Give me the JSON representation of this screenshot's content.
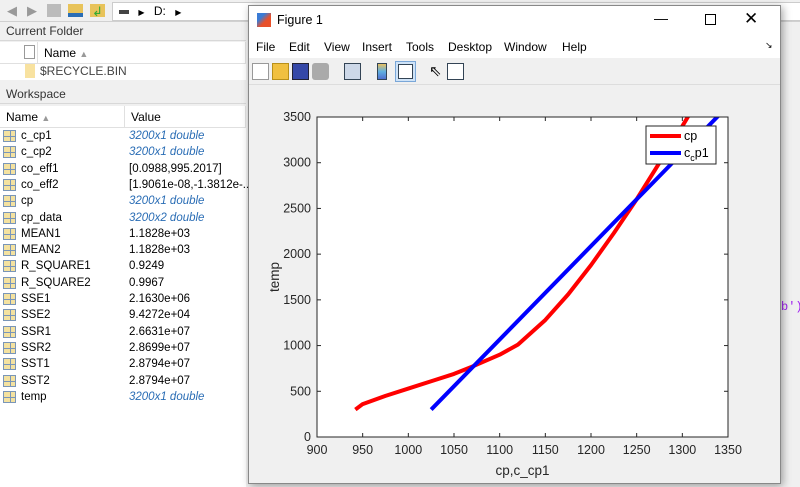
{
  "toolbar": {
    "drive": "D:",
    "icons": [
      "back-arrow-icon",
      "forward-arrow-icon",
      "up-folder-icon",
      "browse-folder-icon",
      "folder-up-icon",
      "drive-icon"
    ]
  },
  "current_folder": {
    "title": "Current Folder",
    "col_name": "Name",
    "items": [
      "$RECYCLE.BIN"
    ]
  },
  "workspace": {
    "title": "Workspace",
    "col_name": "Name",
    "col_value": "Value",
    "rows": [
      {
        "name": "c_cp1",
        "value": "3200x1 double",
        "italic": true
      },
      {
        "name": "c_cp2",
        "value": "3200x1 double",
        "italic": true
      },
      {
        "name": "co_eff1",
        "value": "[0.0988,995.2017]",
        "italic": false
      },
      {
        "name": "co_eff2",
        "value": "[1.9061e-08,-1.3812e-...",
        "italic": false
      },
      {
        "name": "cp",
        "value": "3200x1 double",
        "italic": true
      },
      {
        "name": "cp_data",
        "value": "3200x2 double",
        "italic": true
      },
      {
        "name": "MEAN1",
        "value": "1.1828e+03",
        "italic": false
      },
      {
        "name": "MEAN2",
        "value": "1.1828e+03",
        "italic": false
      },
      {
        "name": "R_SQUARE1",
        "value": "0.9249",
        "italic": false
      },
      {
        "name": "R_SQUARE2",
        "value": "0.9967",
        "italic": false
      },
      {
        "name": "SSE1",
        "value": "2.1630e+06",
        "italic": false
      },
      {
        "name": "SSE2",
        "value": "9.4272e+04",
        "italic": false
      },
      {
        "name": "SSR1",
        "value": "2.6631e+07",
        "italic": false
      },
      {
        "name": "SSR2",
        "value": "2.8699e+07",
        "italic": false
      },
      {
        "name": "SST1",
        "value": "2.8794e+07",
        "italic": false
      },
      {
        "name": "SST2",
        "value": "2.8794e+07",
        "italic": false
      },
      {
        "name": "temp",
        "value": "3200x1 double",
        "italic": true
      }
    ]
  },
  "editor_fragment": "b')",
  "figure": {
    "title": "Figure 1",
    "menus": [
      "File",
      "Edit",
      "View",
      "Insert",
      "Tools",
      "Desktop",
      "Window",
      "Help"
    ],
    "toolbar_icons": [
      "new-figure-icon",
      "open-file-icon",
      "save-icon",
      "print-icon",
      "link-plot-icon",
      "colorbar-icon",
      "legend-icon",
      "pointer-icon",
      "property-editor-icon"
    ]
  },
  "chart_data": {
    "type": "line",
    "xlabel": "cp,c_cp1",
    "ylabel": "temp",
    "xlim": [
      900,
      1350
    ],
    "ylim": [
      0,
      3500
    ],
    "xticks": [
      900,
      950,
      1000,
      1050,
      1100,
      1150,
      1200,
      1250,
      1300,
      1350
    ],
    "yticks": [
      0,
      500,
      1000,
      1500,
      2000,
      2500,
      3000,
      3500
    ],
    "legend": "top-right",
    "series": [
      {
        "name": "cp",
        "color": "#ff0000",
        "x": [
          942,
          950,
          975,
          1000,
          1025,
          1050,
          1070,
          1100,
          1120,
          1150,
          1175,
          1200,
          1225,
          1250,
          1275,
          1300,
          1312
        ],
        "y": [
          300,
          360,
          450,
          530,
          610,
          690,
          770,
          900,
          1010,
          1280,
          1560,
          1880,
          2230,
          2600,
          3000,
          3400,
          3600
        ]
      },
      {
        "name": "c_cp1",
        "color": "#0000ff",
        "x": [
          1025,
          1345
        ],
        "y": [
          300,
          3570
        ]
      }
    ]
  }
}
